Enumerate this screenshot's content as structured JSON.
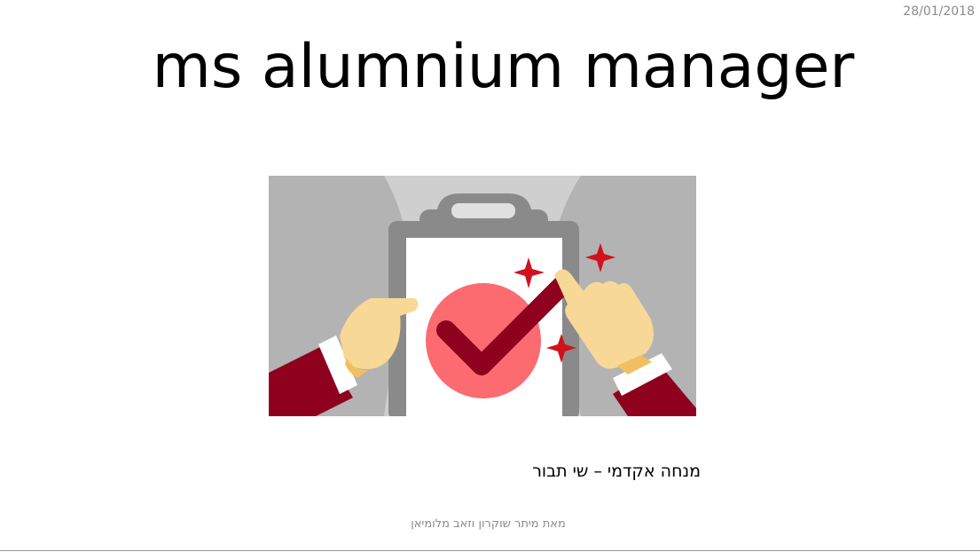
{
  "slide": {
    "date": "28/01/2018",
    "title": "ms alumnium manager",
    "subtitle": "מנחה אקדמי – שי תבור",
    "footer": "מאת מיתר שוקרון וזאב מלומיאן"
  },
  "illustration": {
    "icon": "clipboard-checkmark-illustration",
    "colors": {
      "background": "#b3b3b3",
      "clipboard": "#8a8a8a",
      "paper": "#ffffff",
      "circle": "#fb6b70",
      "check": "#8f001e",
      "sparkle": "#d0121c",
      "sleeve": "#8f001e",
      "skin": "#f7d896"
    }
  }
}
